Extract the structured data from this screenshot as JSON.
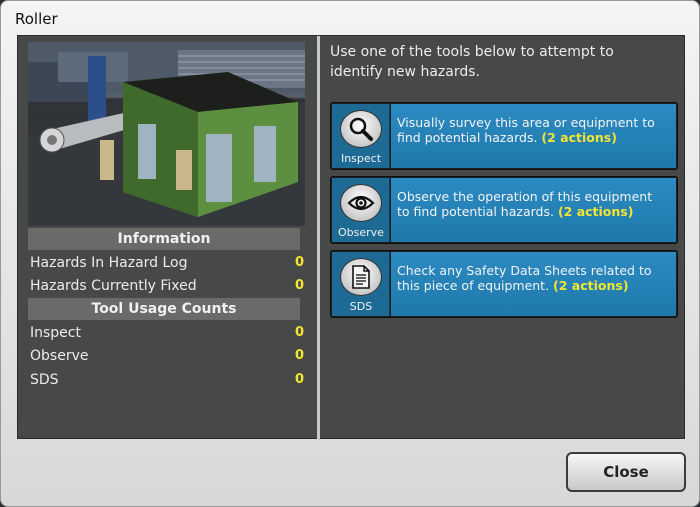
{
  "window": {
    "title": "Roller"
  },
  "left": {
    "information": {
      "header": "Information",
      "rows": [
        {
          "label": "Hazards In Hazard Log",
          "value": "0"
        },
        {
          "label": "Hazards Currently Fixed",
          "value": "0"
        }
      ]
    },
    "tool_usage": {
      "header": "Tool Usage Counts",
      "rows": [
        {
          "label": "Inspect",
          "value": "0"
        },
        {
          "label": "Observe",
          "value": "0"
        },
        {
          "label": "SDS",
          "value": "0"
        }
      ]
    }
  },
  "right": {
    "intro": "Use one of the tools below to attempt to identify new hazards.",
    "tools": [
      {
        "icon": "magnifier-icon",
        "label": "Inspect",
        "desc": "Visually survey this area or equipment to find potential hazards.",
        "actions": "(2 actions)"
      },
      {
        "icon": "eye-icon",
        "label": "Observe",
        "desc": "Observe the operation of this equipment to find potential hazards.",
        "actions": "(2 actions)"
      },
      {
        "icon": "document-icon",
        "label": "SDS",
        "desc": "Check any Safety Data Sheets related to this piece of equipment.",
        "actions": "(2 actions)"
      }
    ]
  },
  "footer": {
    "close_label": "Close"
  },
  "colors": {
    "accent_yellow": "#f2e533",
    "tool_blue": "#2c8bc2",
    "panel_bg": "#474948"
  }
}
